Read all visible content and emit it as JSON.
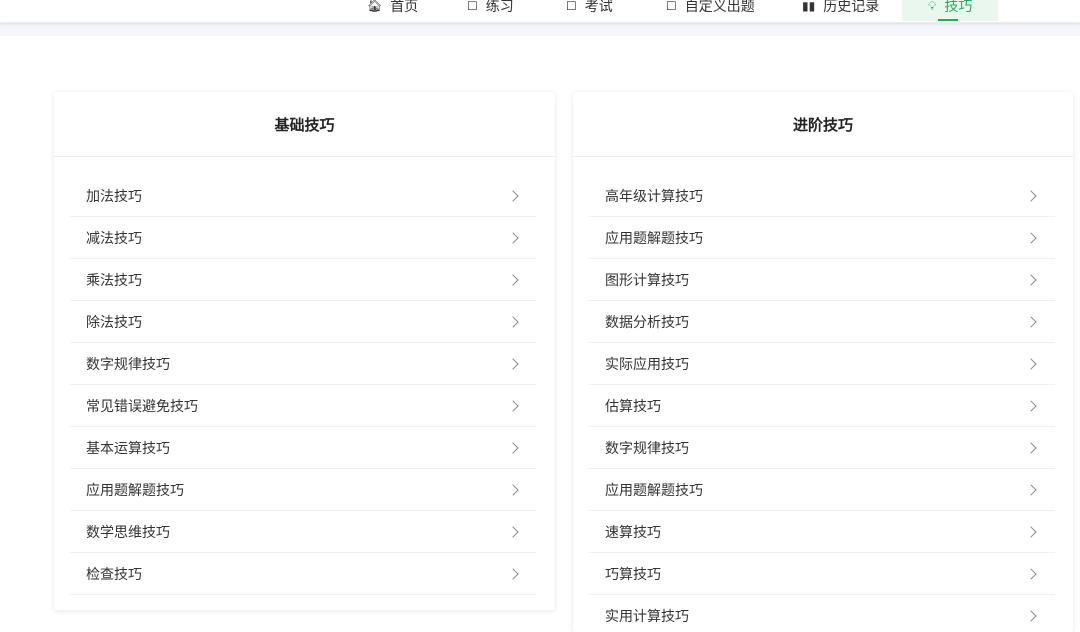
{
  "nav": {
    "items": [
      {
        "label": "首页",
        "icon": "home-icon"
      },
      {
        "label": "练习",
        "icon": "edit-icon"
      },
      {
        "label": "考试",
        "icon": "exam-icon"
      },
      {
        "label": "自定义出题",
        "icon": "custom-icon"
      },
      {
        "label": "历史记录",
        "icon": "bar-chart-icon"
      },
      {
        "label": "技巧",
        "icon": "lightbulb-icon"
      }
    ],
    "active_index": 5,
    "accent_color": "#20b05a",
    "active_bg": "#eaf7ef"
  },
  "basic": {
    "title": "基础技巧",
    "items": [
      {
        "label": "加法技巧"
      },
      {
        "label": "减法技巧"
      },
      {
        "label": "乘法技巧"
      },
      {
        "label": "除法技巧"
      },
      {
        "label": "数字规律技巧"
      },
      {
        "label": "常见错误避免技巧"
      },
      {
        "label": "基本运算技巧"
      },
      {
        "label": "应用题解题技巧"
      },
      {
        "label": "数学思维技巧"
      },
      {
        "label": "检查技巧"
      }
    ]
  },
  "advanced": {
    "title": "进阶技巧",
    "items": [
      {
        "label": "高年级计算技巧"
      },
      {
        "label": "应用题解题技巧"
      },
      {
        "label": "图形计算技巧"
      },
      {
        "label": "数据分析技巧"
      },
      {
        "label": "实际应用技巧"
      },
      {
        "label": "估算技巧"
      },
      {
        "label": "数字规律技巧"
      },
      {
        "label": "应用题解题技巧"
      },
      {
        "label": "速算技巧"
      },
      {
        "label": "巧算技巧"
      },
      {
        "label": "实用计算技巧"
      }
    ]
  }
}
